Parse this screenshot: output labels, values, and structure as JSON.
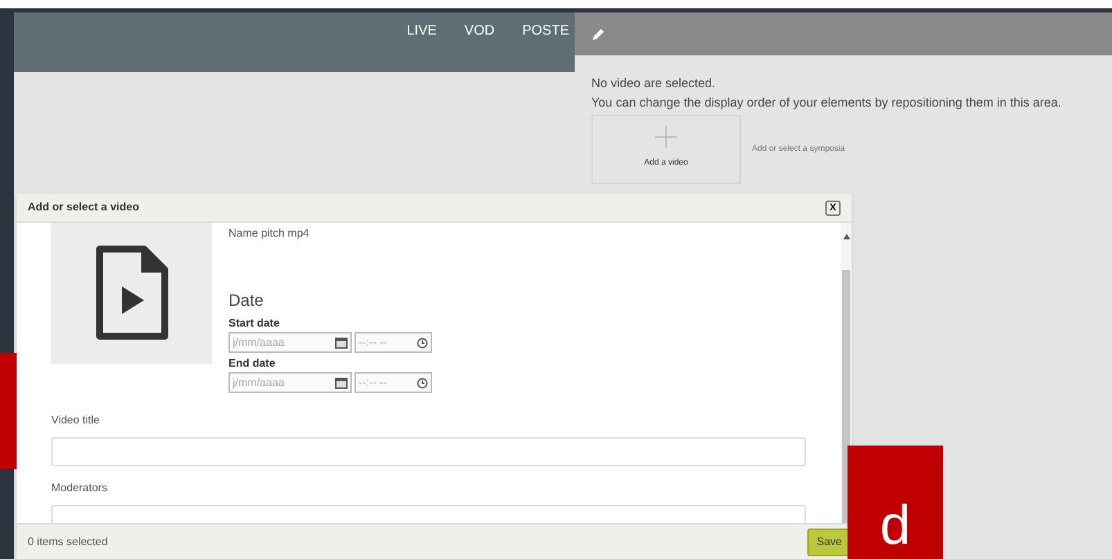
{
  "nav": {
    "items": [
      "LIVE",
      "VOD",
      "POSTE"
    ]
  },
  "panel": {
    "message": "No video are selected.",
    "hint": "You can change the display order of your elements by repositioning them in this area.",
    "add_label": "Add a video",
    "symposia_label": "Add or select a symposia"
  },
  "dialog": {
    "title": "Add or select a video",
    "close": "X",
    "file_name": "Name pitch mp4",
    "date_heading": "Date",
    "dates": [
      {
        "label": "Start date",
        "date_placeholder": "j/mm/aaaa",
        "time_placeholder": "--:-- --"
      },
      {
        "label": "End date",
        "date_placeholder": "j/mm/aaaa",
        "time_placeholder": "--:-- --"
      }
    ],
    "fields": [
      {
        "label": "Video title"
      },
      {
        "label": "Moderators"
      }
    ],
    "status": "0 items selected",
    "save": "Save"
  },
  "tag": {
    "letter": "d"
  }
}
